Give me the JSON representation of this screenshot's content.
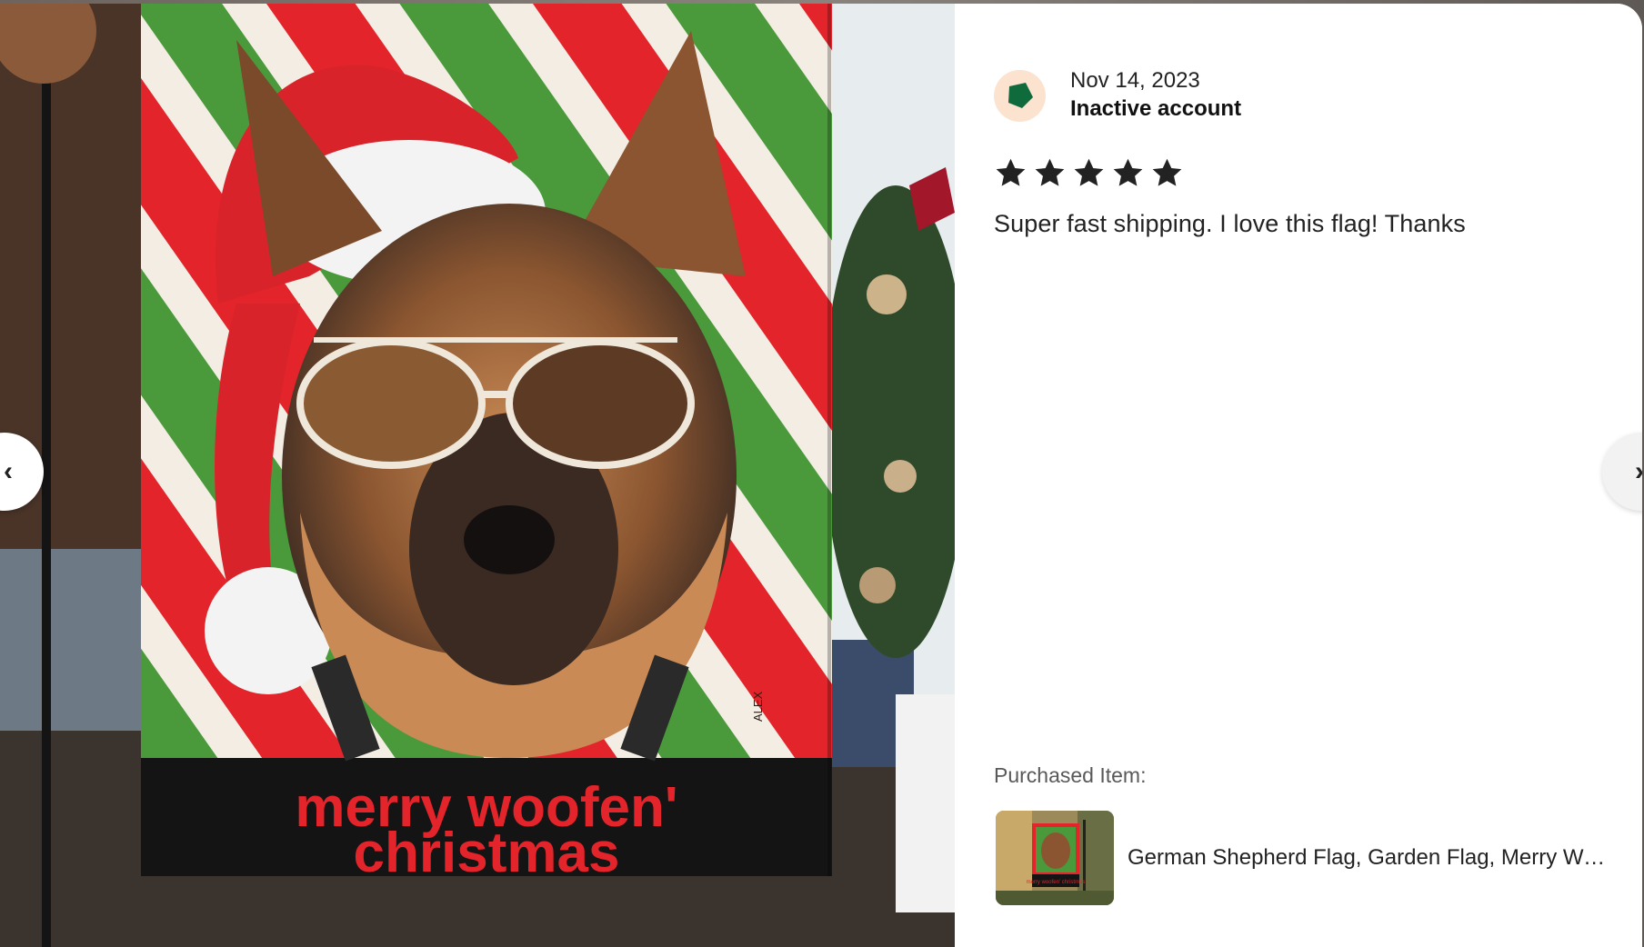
{
  "review": {
    "date": "Nov 14, 2023",
    "reviewer_name": "Inactive account",
    "rating": 5,
    "rating_max": 5,
    "text": "Super fast shipping. I love this flag! Thanks"
  },
  "purchase": {
    "label": "Purchased Item:",
    "item_title": "German Shepherd Flag, Garden Flag, Merry Woofen' Christmas"
  },
  "photo": {
    "flag_caption_line1": "merry woofen'",
    "flag_caption_line2": "christmas",
    "artist_mark": "ALEX"
  },
  "thumbnail": {
    "caption": "merry woofen' christmas"
  },
  "nav": {
    "prev_glyph": "‹",
    "next_glyph": "›"
  },
  "colors": {
    "avatar_bg": "#fbe3cf",
    "avatar_shape": "#0f6b3b",
    "star": "#222222",
    "flag_red": "#e3242b",
    "flag_green": "#4a9a3c"
  },
  "icons": {
    "avatar": "green-pentagon-avatar-icon",
    "star": "star-icon",
    "prev": "chevron-left-icon",
    "next": "chevron-right-icon"
  }
}
